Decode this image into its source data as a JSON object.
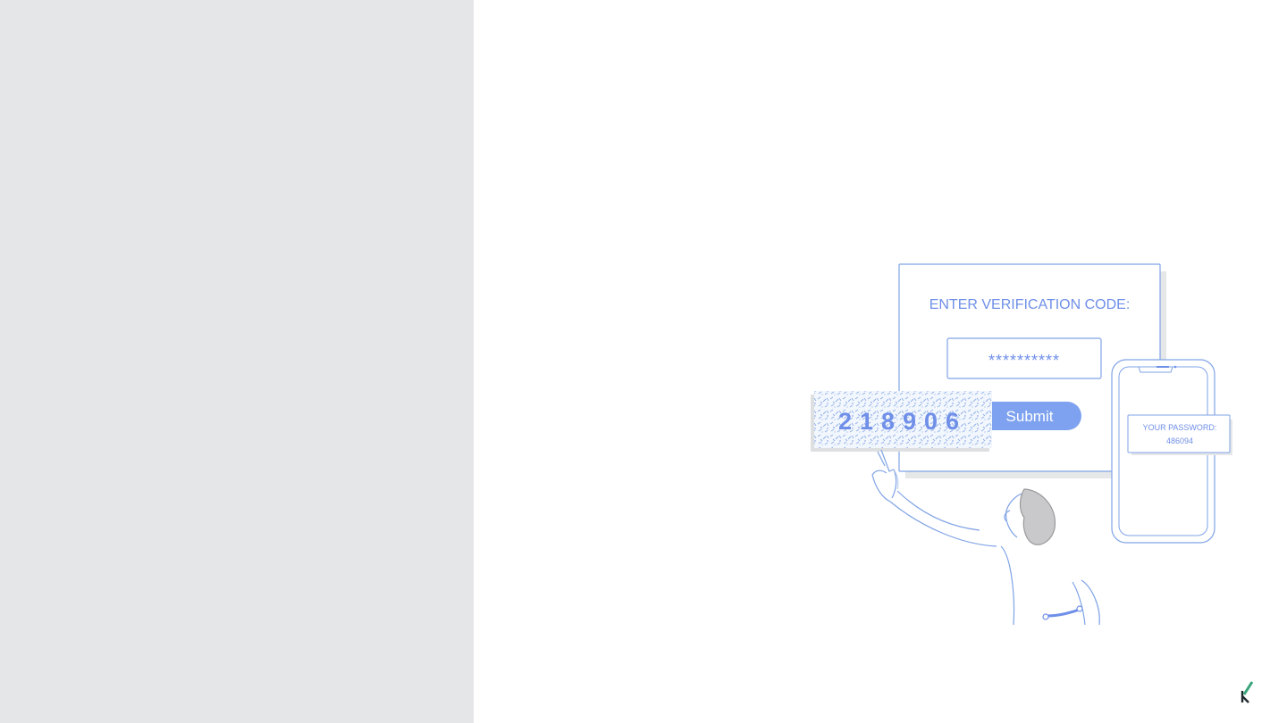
{
  "verification": {
    "heading": "ENTER VERIFICATION CODE:",
    "masked_code": "**********",
    "submit_label": "Submit",
    "captcha_code": "218906"
  },
  "phone": {
    "message_title": "YOUR PASSWORD:",
    "message_code": "486094"
  },
  "colors": {
    "left_panel": "#e5e6e8",
    "accent_blue": "#6f8fe8",
    "line_blue": "#7fa3e6",
    "button_blue": "#7ea2ef",
    "logo_green": "#3aa57a"
  },
  "logo": {
    "icon": "k-logo-icon"
  }
}
